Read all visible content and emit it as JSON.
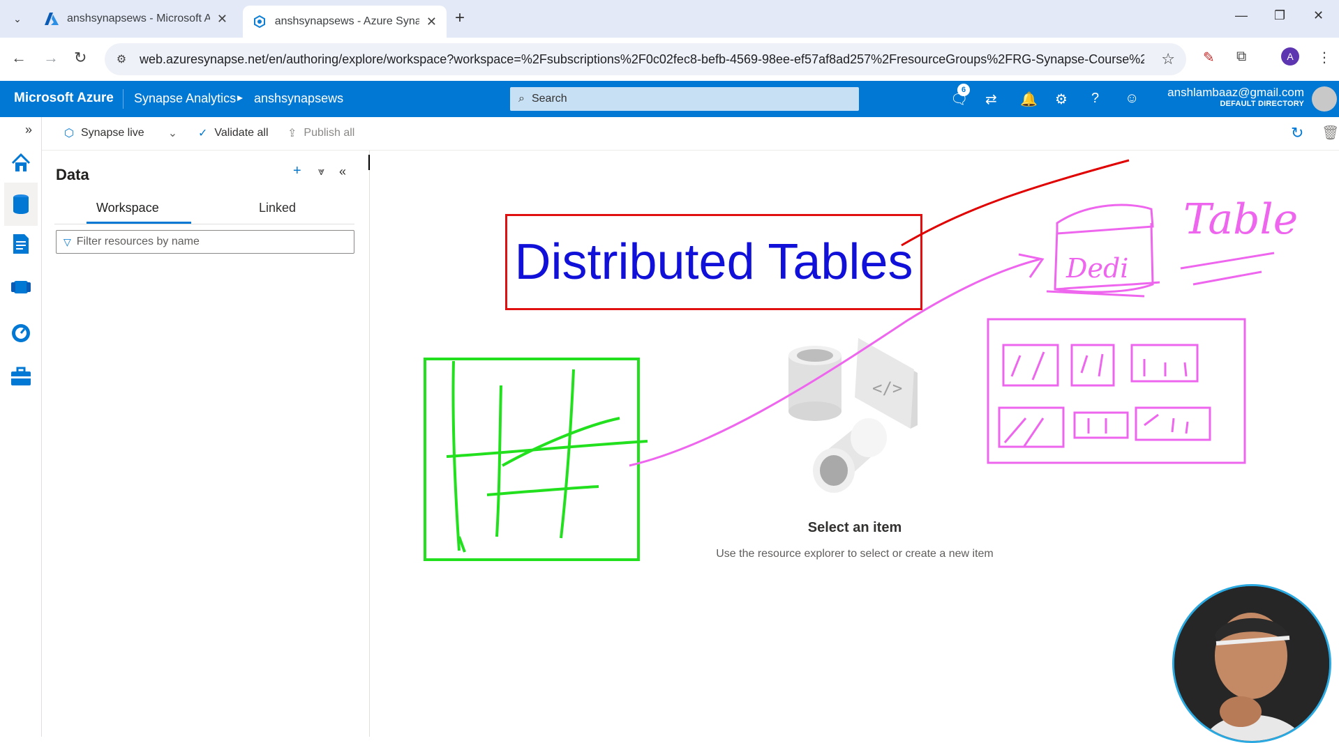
{
  "browser": {
    "tabs": [
      {
        "title": "anshsynapsews - Microsoft Azu",
        "close": "✕"
      },
      {
        "title": "anshsynapsews - Azure Synaps",
        "close": "✕"
      }
    ],
    "new_tab": "+",
    "url": "web.azuresynapse.net/en/authoring/explore/workspace?workspace=%2Fsubscriptions%2F0c02fec8-befb-4569-98ee-ef57af8ad257%2FresourceGroups%2FRG-Synapse-Course%2Fprovid...",
    "profile_initial": "A"
  },
  "azure": {
    "brand": "Microsoft Azure",
    "breadcrumb": [
      "Synapse Analytics",
      "anshsynapsews"
    ],
    "search_placeholder": "Search",
    "notification_count": "6",
    "account_email": "anshlambaaz@gmail.com",
    "account_directory": "DEFAULT DIRECTORY",
    "accent": "#0078d4"
  },
  "commandbar": {
    "mode": "Synapse live",
    "validate_all": "Validate all",
    "publish_all": "Publish all"
  },
  "data_pane": {
    "title": "Data",
    "tabs": [
      "Workspace",
      "Linked"
    ],
    "active_tab": "Workspace",
    "filter_placeholder": "Filter resources by name"
  },
  "main": {
    "empty_title": "Select an item",
    "empty_subtitle": "Use the resource explorer to select or create a new item"
  },
  "annotations": {
    "boxed_title": "Distributed Tables",
    "handwritten_word": "Table",
    "handwritten_node": "Dedi"
  }
}
